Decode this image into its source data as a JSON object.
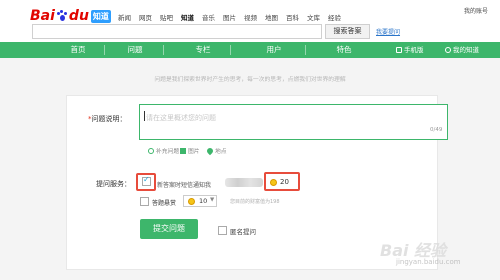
{
  "header": {
    "logo": {
      "bai": "Bai",
      "du": "du",
      "zhidao": "知道"
    },
    "nav": [
      "新闻",
      "网页",
      "贴吧",
      "知道",
      "音乐",
      "图片",
      "视频",
      "地图",
      "百科",
      "文库",
      "经验"
    ],
    "active_nav": "知道",
    "user_link": "我的账号",
    "search_button": "搜索答案",
    "ask_link": "我要提问"
  },
  "green_nav": {
    "items": [
      "首页",
      "问题",
      "专栏",
      "用户",
      "特色"
    ],
    "mobile": "手机版",
    "my_zhidao": "我的知道"
  },
  "slogan": "问题是我们探索世界时产生的思考，每一次的思考，点燃我们对世界的理解",
  "form": {
    "question_label": "问题说明：",
    "required_mark": "*",
    "question_placeholder": "请在这里概述您的问题",
    "char_counter": "0/49",
    "tools": [
      "补充问题",
      "图片",
      "地点"
    ],
    "service_label": "提问服务：",
    "service_text": "新答案时短信通知我",
    "service_cost": "20",
    "reward_label": "答题悬赏",
    "reward_value": "10",
    "wealth_note": "您目前的财富值为198",
    "submit_label": "提交问题",
    "anonymous_label": "匿名提问"
  },
  "watermark": {
    "main": "Bai 经验",
    "sub": "jingyan.baidu.com"
  },
  "colors": {
    "brand_green": "#3db66b",
    "highlight_red": "#e74c3c",
    "baidu_red": "#e10601",
    "baidu_blue": "#2932e1"
  }
}
